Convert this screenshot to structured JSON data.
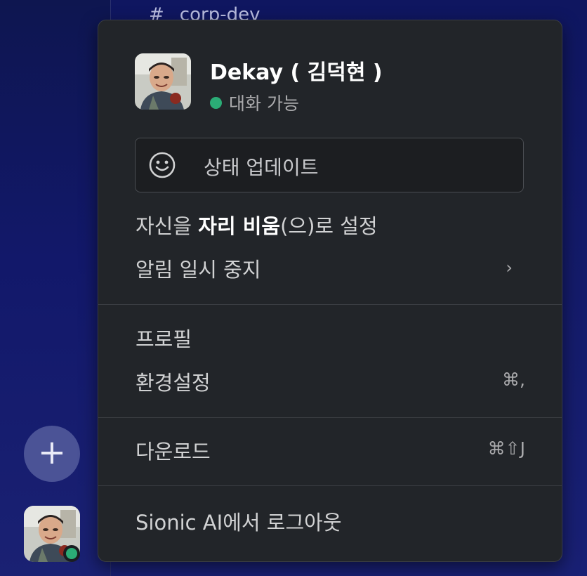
{
  "background": {
    "channel_hash": "#",
    "channel_name": "corp-dev"
  },
  "rail": {
    "add_symbol": "+"
  },
  "menu": {
    "user_name": "Dekay ( 김덕현 )",
    "presence": "대화 가능",
    "status_placeholder": "상태 업데이트",
    "set_away": {
      "prefix": "자신을 ",
      "bold": "자리 비움",
      "suffix": "(으)로 설정"
    },
    "pause_notifications": "알림 일시 중지",
    "chevron": "›",
    "profile": "프로필",
    "preferences": "환경설정",
    "preferences_shortcut": "⌘,",
    "downloads": "다운로드",
    "downloads_shortcut": "⌘⇧J",
    "sign_out": "Sionic AI에서 로그아웃"
  },
  "colors": {
    "presence_active": "#2bac76",
    "menu_bg": "#222529",
    "rail_bg": "#12186a"
  }
}
